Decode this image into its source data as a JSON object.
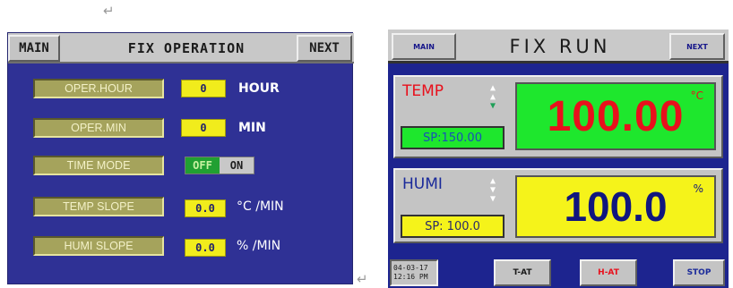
{
  "left_screen": {
    "header": {
      "main_label": "MAIN",
      "title": "FIX OPERATION",
      "next_label": "NEXT"
    },
    "rows": [
      {
        "label": "OPER.HOUR",
        "value": "0",
        "unit": "HOUR"
      },
      {
        "label": "OPER.MIN",
        "value": "0",
        "unit": "MIN"
      },
      {
        "label": "TIME MODE",
        "toggle_off": "OFF",
        "toggle_on": "ON"
      },
      {
        "label": "TEMP SLOPE",
        "value": "0.0",
        "unit": "°C /MIN"
      },
      {
        "label": "HUMI SLOPE",
        "value": "0.0",
        "unit": "% /MIN"
      }
    ]
  },
  "right_screen": {
    "header": {
      "main_label": "MAIN",
      "title": "FIX RUN",
      "next_label": "NEXT"
    },
    "temp": {
      "label": "TEMP",
      "setpoint": "SP:150.00",
      "value": "100.00",
      "unit": "°C"
    },
    "humi": {
      "label": "HUMI",
      "setpoint": "SP: 100.0",
      "value": "100.0",
      "unit": "%"
    },
    "footer": {
      "date": "04-03-17",
      "time": "12:16 PM",
      "t_at_label": "T-AT",
      "h_at_label": "H-AT",
      "stop_label": "STOP"
    }
  },
  "colors": {
    "panel_blue": "#2f3195",
    "label_olive": "#a5a35c",
    "value_yellow": "#f1ec1c",
    "temp_green": "#1ee72d",
    "temp_red": "#e8101c",
    "humi_yellow": "#f5f31a",
    "humi_blue": "#10167e"
  },
  "icons": [
    "return-arrow-icon",
    "paragraph-mark-icon",
    "up-down-arrow-icon"
  ]
}
